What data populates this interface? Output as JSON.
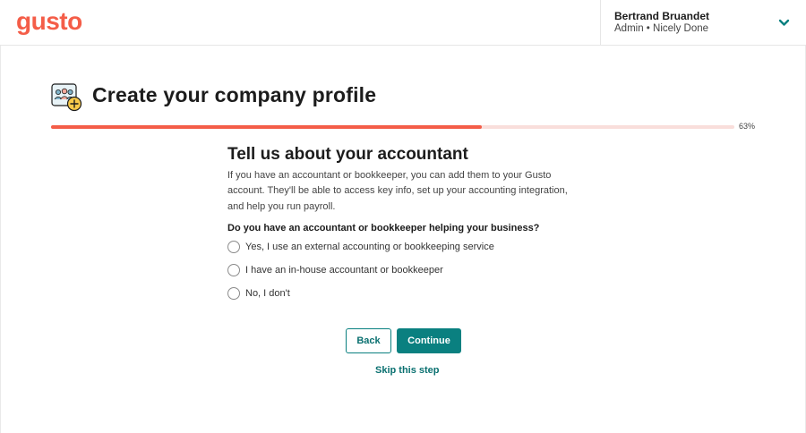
{
  "header": {
    "logo_text": "gusto",
    "user_name": "Bertrand Bruandet",
    "user_role": "Admin • Nicely Done"
  },
  "page": {
    "title": "Create your company profile",
    "progress_value": 0.63,
    "progress_label": "63%"
  },
  "section": {
    "title": "Tell us about your accountant",
    "description": "If you have an accountant or bookkeeper, you can add them to your Gusto account. They'll be able to access key info, set up your accounting integration, and help you run payroll."
  },
  "form": {
    "question": "Do you have an accountant or bookkeeper helping your business?",
    "options": [
      {
        "label": "Yes, I use an external accounting or bookkeeping service",
        "selected": false
      },
      {
        "label": "I have an in-house accountant or bookkeeper",
        "selected": false
      },
      {
        "label": "No, I don't",
        "selected": false
      }
    ]
  },
  "actions": {
    "back_label": "Back",
    "continue_label": "Continue",
    "skip_label": "Skip this step"
  },
  "colors": {
    "brand": "#f45d48",
    "primary": "#0a8080",
    "progress_track": "#f9dedb"
  },
  "icons": {
    "header_icon": "company-people-add-icon",
    "dropdown": "chevron-down-icon"
  }
}
